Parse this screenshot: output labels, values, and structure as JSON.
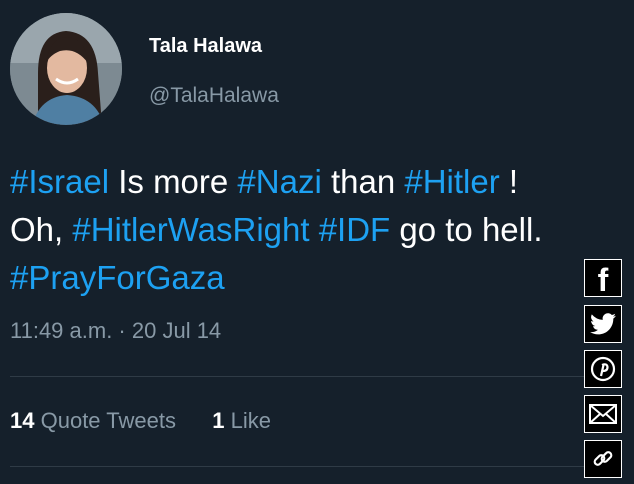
{
  "author": {
    "name": "Tala Halawa",
    "handle": "@TalaHalawa"
  },
  "tweet": {
    "segments_line1": [
      {
        "text": "#Israel",
        "tag": true
      },
      {
        "text": " Is more ",
        "tag": false
      },
      {
        "text": "#Nazi",
        "tag": true
      },
      {
        "text": " than ",
        "tag": false
      },
      {
        "text": "#Hitler",
        "tag": true
      },
      {
        "text": " !",
        "tag": false
      }
    ],
    "segments_line2": [
      {
        "text": "Oh, ",
        "tag": false
      },
      {
        "text": "#HitlerWasRight",
        "tag": true
      },
      {
        "text": " ",
        "tag": false
      },
      {
        "text": "#IDF",
        "tag": true
      },
      {
        "text": " go to hell.",
        "tag": false
      }
    ],
    "segments_line3": [
      {
        "text": "#PrayForGaza",
        "tag": true
      }
    ],
    "timestamp": "11:49 a.m. · 20 Jul 14"
  },
  "stats": {
    "quote_count": "14",
    "quote_label": "Quote Tweets",
    "like_count": "1",
    "like_label": "Like"
  },
  "share_bar": {
    "icons": [
      "facebook-icon",
      "twitter-icon",
      "pinterest-icon",
      "email-icon",
      "link-icon"
    ],
    "facebook_glyph": "f"
  },
  "colors": {
    "background": "#15202b",
    "hashtag": "#1da1f2",
    "muted": "#8899a6"
  }
}
